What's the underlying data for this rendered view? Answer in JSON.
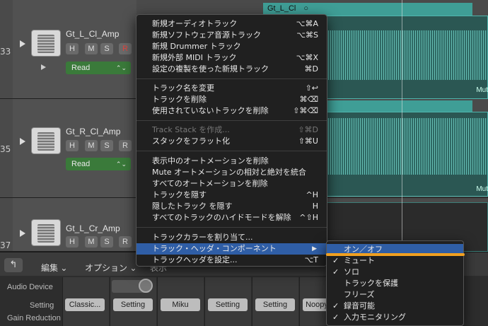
{
  "tracks": [
    {
      "number": "33",
      "name": "Gt_L_Cl_Amp",
      "buttons": [
        "H",
        "M",
        "S",
        "R"
      ],
      "automation": "Read"
    },
    {
      "number": "35",
      "name": "Gt_R_Cl_Amp",
      "buttons": [
        "H",
        "M",
        "S",
        "R"
      ],
      "automation": "Read"
    },
    {
      "number": "37",
      "name": "Gt_L_Cr_Amp",
      "buttons": [
        "H",
        "M",
        "S",
        "R"
      ],
      "automation": ""
    }
  ],
  "automation_partial": "M",
  "regions": {
    "top_label": "Gt_L_Cl",
    "mute_label": "Mut"
  },
  "context_menu": {
    "groups": [
      [
        {
          "label": "新規オーディオトラック",
          "shortcut": "⌥⌘A"
        },
        {
          "label": "新規ソフトウェア音源トラック",
          "shortcut": "⌥⌘S"
        },
        {
          "label": "新規 Drummer トラック",
          "shortcut": ""
        },
        {
          "label": "新規外部 MIDI トラック",
          "shortcut": "⌥⌘X"
        },
        {
          "label": "設定の複製を使った新規トラック",
          "shortcut": "⌘D"
        }
      ],
      [
        {
          "label": "トラック名を変更",
          "shortcut": "⇧↩"
        },
        {
          "label": "トラックを削除",
          "shortcut": "⌘⌫"
        },
        {
          "label": "使用されていないトラックを削除",
          "shortcut": "⇧⌘⌫"
        }
      ],
      [
        {
          "label": "Track Stack を作成...",
          "shortcut": "⇧⌘D",
          "disabled": true
        },
        {
          "label": "スタックをフラット化",
          "shortcut": "⇧⌘U"
        }
      ],
      [
        {
          "label": "表示中のオートメーションを削除",
          "shortcut": ""
        },
        {
          "label": "Mute オートメーションの相対と絶対を統合",
          "shortcut": ""
        },
        {
          "label": "すべてのオートメーションを削除",
          "shortcut": ""
        },
        {
          "label": "トラックを隠す",
          "shortcut": "^H"
        },
        {
          "label": "隠したトラック を隠す",
          "shortcut": "H"
        },
        {
          "label": "すべてのトラックのハイドモードを解除",
          "shortcut": "^⇧H"
        }
      ],
      [
        {
          "label": "トラックカラーを割り当て...",
          "shortcut": ""
        },
        {
          "label": "トラック・ヘッダ・コンポーネント",
          "shortcut": "",
          "submenu": true,
          "highlighted": true
        },
        {
          "label": "トラックヘッダを設定...",
          "shortcut": "⌥T"
        }
      ]
    ]
  },
  "submenu": {
    "items": [
      {
        "label": "オン／オフ",
        "checked": false,
        "highlighted": true
      },
      {
        "label": "ミュート",
        "checked": true
      },
      {
        "label": "ソロ",
        "checked": true
      },
      {
        "label": "トラックを保護",
        "checked": false
      },
      {
        "label": "フリーズ",
        "checked": false
      },
      {
        "label": "録音可能",
        "checked": true
      },
      {
        "label": "入力モニタリング",
        "checked": true
      }
    ]
  },
  "toolbar": {
    "back_icon": "↰",
    "menus": [
      "編集",
      "オプション"
    ],
    "extra": "表示"
  },
  "mixer": {
    "labels": [
      "Audio Device",
      "Setting",
      "Gain Reduction"
    ],
    "settings": [
      "Classic...",
      "Setting",
      "Miku",
      "Setting",
      "Setting",
      "Noopy"
    ]
  },
  "colors": {
    "region": "#3f9e96",
    "highlight": "#2f5ea6",
    "read_green": "#3a7a3a",
    "record_red": "#e0443e",
    "annotation": "#f0a020"
  }
}
